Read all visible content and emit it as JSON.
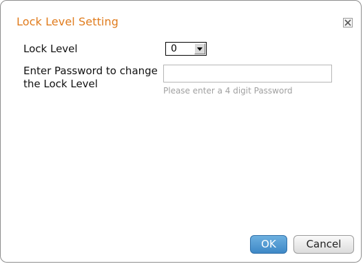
{
  "dialog": {
    "title": "Lock Level Setting",
    "close_icon": "close-icon"
  },
  "form": {
    "lock_level_label": "Lock Level",
    "lock_level_value": "0",
    "password_label": "Enter Password to change the Lock Level",
    "password_value": "",
    "password_hint": "Please enter a 4 digit Password"
  },
  "buttons": {
    "ok_label": "OK",
    "cancel_label": "Cancel"
  },
  "colors": {
    "title": "#e07b1c",
    "ok_button": "#4a92cf",
    "hint": "#a0a0a0"
  }
}
